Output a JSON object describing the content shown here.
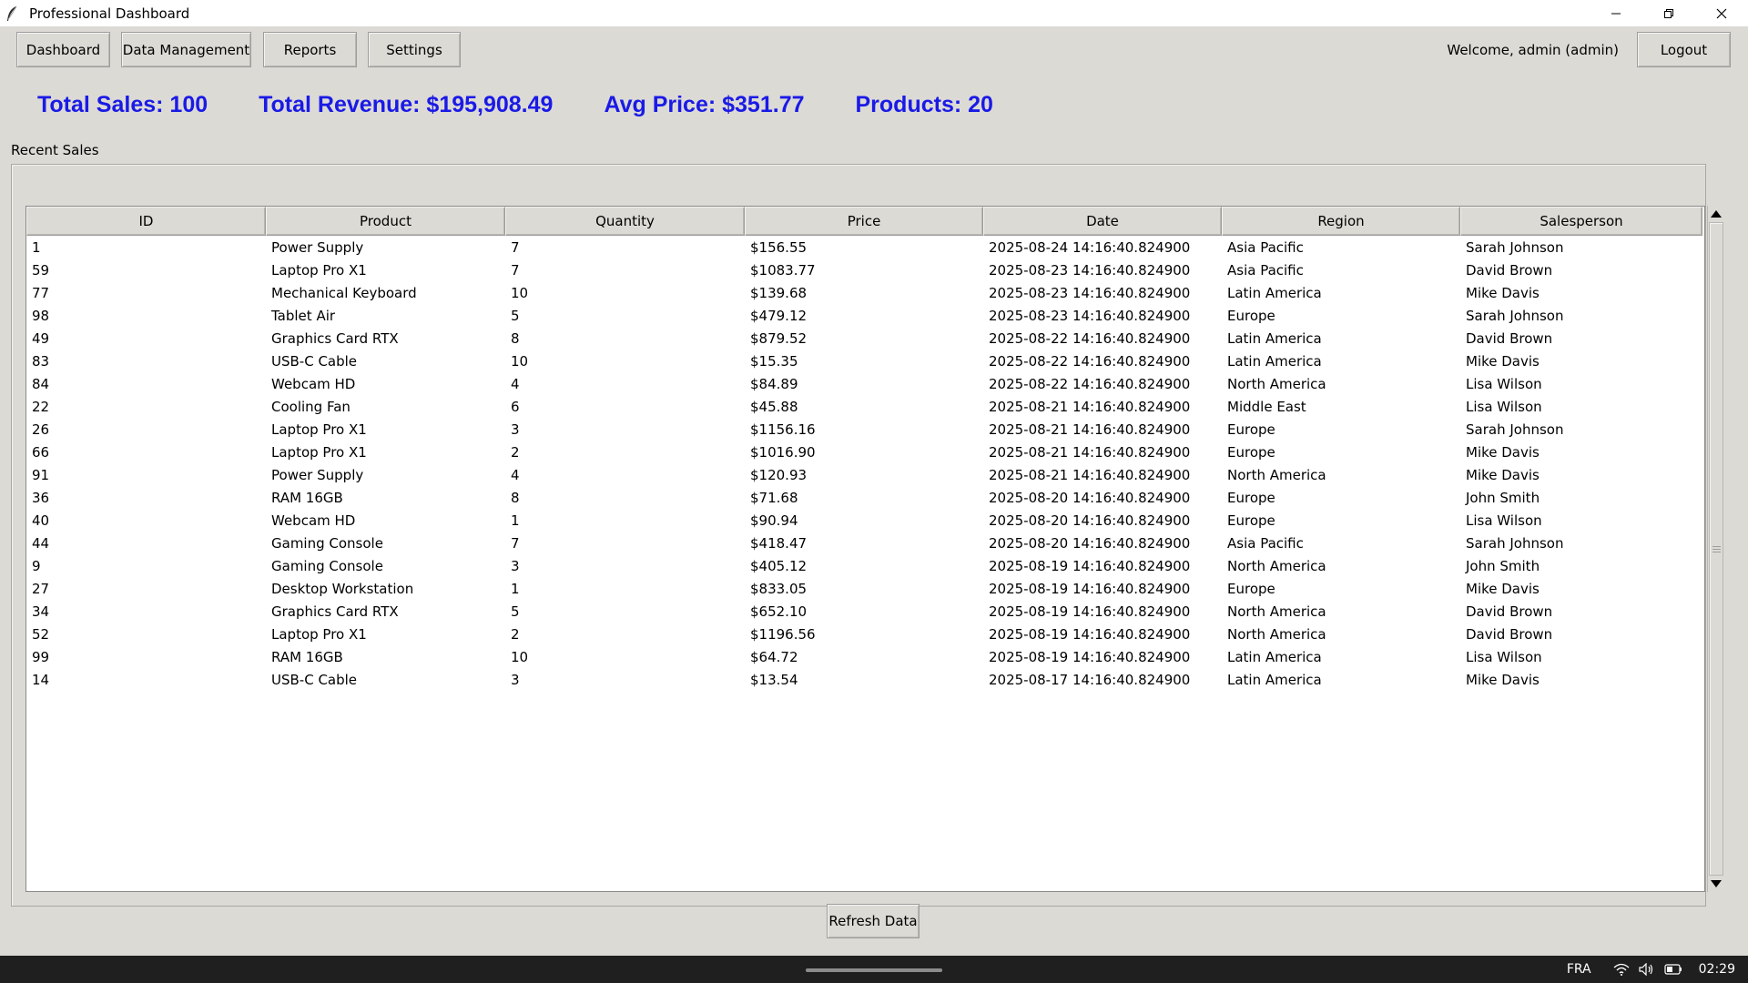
{
  "window": {
    "title": "Professional Dashboard"
  },
  "nav": {
    "dashboard": "Dashboard",
    "data_management": "Data Management",
    "reports": "Reports",
    "settings": "Settings"
  },
  "user": {
    "welcome": "Welcome, admin (admin)",
    "logout": "Logout"
  },
  "stats": {
    "total_sales": "Total Sales: 100",
    "total_revenue": "Total Revenue: $195,908.49",
    "avg_price": "Avg Price: $351.77",
    "products": "Products: 20"
  },
  "recent_sales": {
    "label": "Recent Sales",
    "columns": [
      "ID",
      "Product",
      "Quantity",
      "Price",
      "Date",
      "Region",
      "Salesperson"
    ],
    "rows": [
      [
        "1",
        "Power Supply",
        "7",
        "$156.55",
        "2025-08-24 14:16:40.824900",
        "Asia Pacific",
        "Sarah Johnson"
      ],
      [
        "59",
        "Laptop Pro X1",
        "7",
        "$1083.77",
        "2025-08-23 14:16:40.824900",
        "Asia Pacific",
        "David Brown"
      ],
      [
        "77",
        "Mechanical Keyboard",
        "10",
        "$139.68",
        "2025-08-23 14:16:40.824900",
        "Latin America",
        "Mike Davis"
      ],
      [
        "98",
        "Tablet Air",
        "5",
        "$479.12",
        "2025-08-23 14:16:40.824900",
        "Europe",
        "Sarah Johnson"
      ],
      [
        "49",
        "Graphics Card RTX",
        "8",
        "$879.52",
        "2025-08-22 14:16:40.824900",
        "Latin America",
        "David Brown"
      ],
      [
        "83",
        "USB-C Cable",
        "10",
        "$15.35",
        "2025-08-22 14:16:40.824900",
        "Latin America",
        "Mike Davis"
      ],
      [
        "84",
        "Webcam HD",
        "4",
        "$84.89",
        "2025-08-22 14:16:40.824900",
        "North America",
        "Lisa Wilson"
      ],
      [
        "22",
        "Cooling Fan",
        "6",
        "$45.88",
        "2025-08-21 14:16:40.824900",
        "Middle East",
        "Lisa Wilson"
      ],
      [
        "26",
        "Laptop Pro X1",
        "3",
        "$1156.16",
        "2025-08-21 14:16:40.824900",
        "Europe",
        "Sarah Johnson"
      ],
      [
        "66",
        "Laptop Pro X1",
        "2",
        "$1016.90",
        "2025-08-21 14:16:40.824900",
        "Europe",
        "Mike Davis"
      ],
      [
        "91",
        "Power Supply",
        "4",
        "$120.93",
        "2025-08-21 14:16:40.824900",
        "North America",
        "Mike Davis"
      ],
      [
        "36",
        "RAM 16GB",
        "8",
        "$71.68",
        "2025-08-20 14:16:40.824900",
        "Europe",
        "John Smith"
      ],
      [
        "40",
        "Webcam HD",
        "1",
        "$90.94",
        "2025-08-20 14:16:40.824900",
        "Europe",
        "Lisa Wilson"
      ],
      [
        "44",
        "Gaming Console",
        "7",
        "$418.47",
        "2025-08-20 14:16:40.824900",
        "Asia Pacific",
        "Sarah Johnson"
      ],
      [
        "9",
        "Gaming Console",
        "3",
        "$405.12",
        "2025-08-19 14:16:40.824900",
        "North America",
        "John Smith"
      ],
      [
        "27",
        "Desktop Workstation",
        "1",
        "$833.05",
        "2025-08-19 14:16:40.824900",
        "Europe",
        "Mike Davis"
      ],
      [
        "34",
        "Graphics Card RTX",
        "5",
        "$652.10",
        "2025-08-19 14:16:40.824900",
        "North America",
        "David Brown"
      ],
      [
        "52",
        "Laptop Pro X1",
        "2",
        "$1196.56",
        "2025-08-19 14:16:40.824900",
        "North America",
        "David Brown"
      ],
      [
        "99",
        "RAM 16GB",
        "10",
        "$64.72",
        "2025-08-19 14:16:40.824900",
        "Latin America",
        "Lisa Wilson"
      ],
      [
        "14",
        "USB-C Cable",
        "3",
        "$13.54",
        "2025-08-17 14:16:40.824900",
        "Latin America",
        "Mike Davis"
      ]
    ]
  },
  "actions": {
    "refresh": "Refresh Data"
  },
  "taskbar": {
    "language": "FRA",
    "clock": "02:29"
  },
  "colors": {
    "stat_text": "#1a1ae6",
    "app_background": "#dcdad5",
    "table_background": "#ffffff",
    "taskbar": "#1f1f1f"
  },
  "icons": {
    "app": "feather-icon",
    "minimize": "minimize-icon",
    "restore": "restore-icon",
    "close": "close-icon",
    "scroll_up": "arrow-up-icon",
    "scroll_down": "arrow-down-icon",
    "wifi": "wifi-icon",
    "volume": "volume-icon",
    "battery": "battery-icon"
  }
}
